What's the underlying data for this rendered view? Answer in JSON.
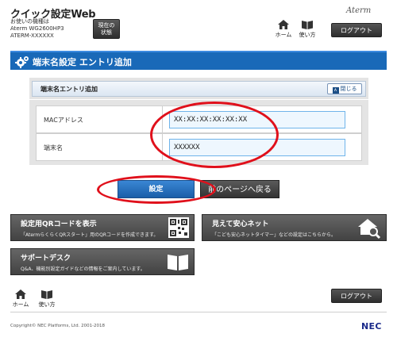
{
  "header": {
    "app_title": "クイック設定Web",
    "model_label": "お使いの機種は",
    "model_name": "Aterm WG2600HP3",
    "device_id": "ATERM-XXXXXX",
    "status_button": [
      "現在の",
      "状態"
    ],
    "brand": "Aterm",
    "home_label": "ホーム",
    "guide_label": "使い方",
    "logout_label": "ログアウト"
  },
  "section": {
    "title": "端末名設定 エントリ追加"
  },
  "panel": {
    "subtitle": "端末名エントリ追加",
    "close_label": "閉じる",
    "fields": [
      {
        "label": "MACアドレス",
        "value": "XX:XX:XX:XX:XX:XX"
      },
      {
        "label": "端末名",
        "value": "XXXXXX"
      }
    ]
  },
  "actions": {
    "set_label": "設定",
    "back_label": "前のページへ戻る"
  },
  "tiles": [
    {
      "title": "設定用QRコードを表示",
      "desc": "「AtermらくらくQRスタート」用のQRコードを作成できます。"
    },
    {
      "title": "見えて安心ネット",
      "desc": "「こども安心ネットタイマー」などの設定はこちらから。"
    },
    {
      "title": "サポートデスク",
      "desc": "Q&A、機能別設定ガイドなどの情報をご案内しています。"
    }
  ],
  "footer": {
    "home_label": "ホーム",
    "guide_label": "使い方",
    "logout_label": "ログアウト",
    "copyright": "Copyright© NEC Platforms, Ltd. 2001-2018",
    "logo": "NEC"
  },
  "colors": {
    "accent_blue": "#1969b8",
    "highlight_red": "#e0101b"
  }
}
